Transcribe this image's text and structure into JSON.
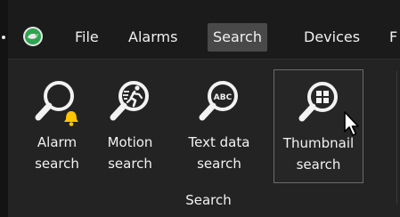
{
  "menubar": {
    "app_icon": "milestone-logo-icon",
    "items": [
      {
        "label": "File",
        "active": false
      },
      {
        "label": "Alarms",
        "active": false
      },
      {
        "label": "Search",
        "active": true
      },
      {
        "label": "Devices",
        "active": false
      },
      {
        "label": "F",
        "active": false
      }
    ]
  },
  "ribbon": {
    "buttons": [
      {
        "line1": "Alarm",
        "line2": "search",
        "icon": "alarm-search-icon",
        "selected": false
      },
      {
        "line1": "Motion",
        "line2": "search",
        "icon": "motion-search-icon",
        "selected": false
      },
      {
        "line1": "Text data",
        "line2": "search",
        "icon": "text-data-search-icon",
        "selected": false
      },
      {
        "line1": "Thumbnail",
        "line2": "search",
        "icon": "thumbnail-search-icon",
        "selected": true
      }
    ],
    "group_label": "Search"
  },
  "colors": {
    "background": "#1b1b1b",
    "ribbon": "#232323",
    "active_menu": "#494949",
    "logo_green": "#2ea44f",
    "bell_yellow": "#ffc400",
    "text": "#f0f0f0"
  }
}
